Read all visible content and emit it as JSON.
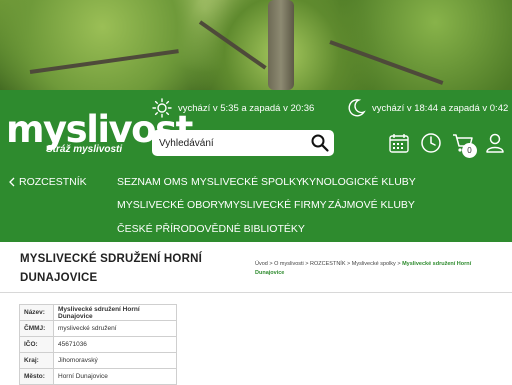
{
  "hero": {
    "image": "forest-trees-photo"
  },
  "header": {
    "logo": {
      "title": "myslivost",
      "subtitle": "Stráž myslivosti"
    },
    "sun": {
      "icon": "sun-icon",
      "text": "vychází v 5:35 a zapadá v 20:36"
    },
    "moon": {
      "icon": "moon-icon",
      "text": "vychází v 18:44 a zapadá v 0:42"
    },
    "search": {
      "placeholder": "Vyhledávání",
      "icon": "search-icon"
    },
    "icons": [
      "calendar-icon",
      "clock-icon",
      "cart-icon",
      "user-icon"
    ],
    "cart_count": "0",
    "accent": "#2e8b2e"
  },
  "nav": {
    "back": "ROZCESTNÍK",
    "items": [
      "SEZNAM OMS",
      "MYSLIVECKÉ SPOLKY",
      "KYNOLOGICKÉ KLUBY",
      "MYSLIVECKÉ OBORY",
      "MYSLIVECKÉ FIRMY",
      "ZÁJMOVÉ KLUBY",
      "ČESKÉ PŘÍRODOVĚDNÉ BIBLIOTÉKY"
    ]
  },
  "page": {
    "title": "MYSLIVECKÉ SDRUŽENÍ HORNÍ DUNAJOVICE",
    "breadcrumb": [
      "Úvod",
      "O myslivosti",
      "ROZCESTNÍK",
      "Myslivecké spolky",
      "Myslivecké sdružení Horní Dunajovice"
    ],
    "separator": ">"
  },
  "info_table": [
    {
      "key": "Název:",
      "value": "Myslivecké sdružení Horní Dunajovice"
    },
    {
      "key": "ČMMJ:",
      "value": "myslivecké sdružení"
    },
    {
      "key": "IČO:",
      "value": "45671036"
    },
    {
      "key": "Kraj:",
      "value": "Jihomoravský"
    },
    {
      "key": "Město:",
      "value": "Horní Dunajovice"
    }
  ]
}
